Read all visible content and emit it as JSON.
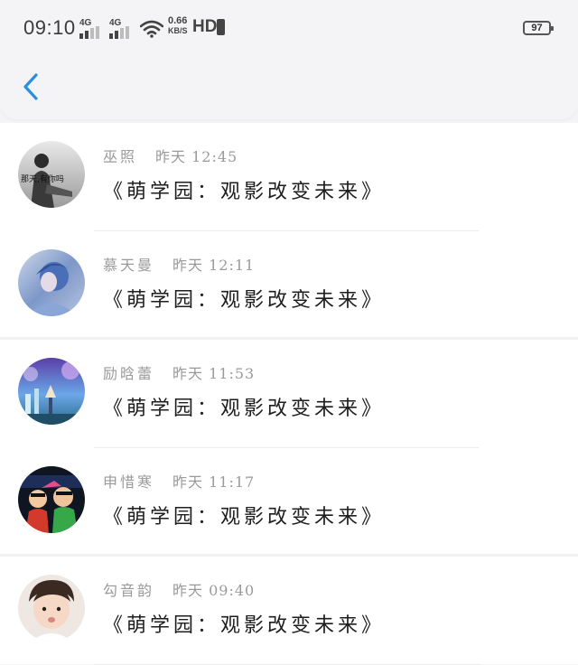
{
  "status_bar": {
    "time": "09:10",
    "network_1": "4G",
    "network_2": "4G",
    "speed_value": "0.66",
    "speed_unit": "KB/S",
    "hd": "HD",
    "battery": "97"
  },
  "list": {
    "items": [
      {
        "author": "巫照",
        "time": "昨天 12:45",
        "title": "《萌学园：观影改变未来》",
        "avatar_text": "那天,有你吗",
        "avatar_icon": "avatar-girl-with-text"
      },
      {
        "author": "慕天曼",
        "time": "昨天 12:11",
        "title": "《萌学园：观影改变未来》",
        "avatar_icon": "avatar-blue-illustration"
      },
      {
        "author": "励晗蕾",
        "time": "昨天 11:53",
        "title": "《萌学园：观影改变未来》",
        "avatar_icon": "avatar-anime-scenery"
      },
      {
        "author": "申惜寒",
        "time": "昨天 11:17",
        "title": "《萌学园：观影改变未来》",
        "avatar_icon": "avatar-cartoon-group"
      },
      {
        "author": "勾音韵",
        "time": "昨天 09:40",
        "title": "《萌学园：观影改变未来》",
        "avatar_icon": "avatar-boy-photo"
      }
    ]
  },
  "colors": {
    "accent": "#2a8fe0",
    "background": "#f4f4f6",
    "meta_text": "#9a9a9a",
    "title_text": "#1e1e1e"
  }
}
